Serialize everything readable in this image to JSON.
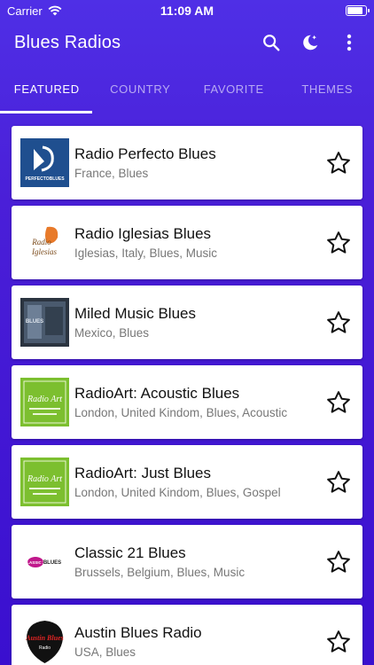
{
  "status": {
    "carrier": "Carrier",
    "time": "11:09 AM"
  },
  "appbar": {
    "title": "Blues Radios",
    "icons": [
      "search-icon",
      "night-mode-icon",
      "more-vert-icon"
    ]
  },
  "tabs": [
    {
      "label": "FEATURED",
      "active": true
    },
    {
      "label": "COUNTRY",
      "active": false
    },
    {
      "label": "FAVORITE",
      "active": false
    },
    {
      "label": "THEMES",
      "active": false
    }
  ],
  "stations": [
    {
      "name": "Radio Perfecto Blues",
      "tags": "France, Blues",
      "logo_text": "PERFECTOBLUES"
    },
    {
      "name": "Radio Iglesias Blues",
      "tags": "Iglesias, Italy, Blues, Music",
      "logo_text": "Iglesias"
    },
    {
      "name": "Miled Music Blues",
      "tags": "Mexico, Blues",
      "logo_text": "BLUES"
    },
    {
      "name": "RadioArt: Acoustic Blues",
      "tags": "London, United Kindom, Blues, Acoustic",
      "logo_text": "Radio Art"
    },
    {
      "name": "RadioArt: Just Blues",
      "tags": "London, United Kindom, Blues, Gospel",
      "logo_text": "Radio Art"
    },
    {
      "name": "Classic 21 Blues",
      "tags": "Brussels, Belgium, Blues, Music",
      "logo_text": "BLUES"
    },
    {
      "name": "Austin Blues Radio",
      "tags": "USA, Blues",
      "logo_text": "Austin Blues"
    }
  ],
  "colors": {
    "accent": "#4a1fd8",
    "card": "#ffffff"
  }
}
